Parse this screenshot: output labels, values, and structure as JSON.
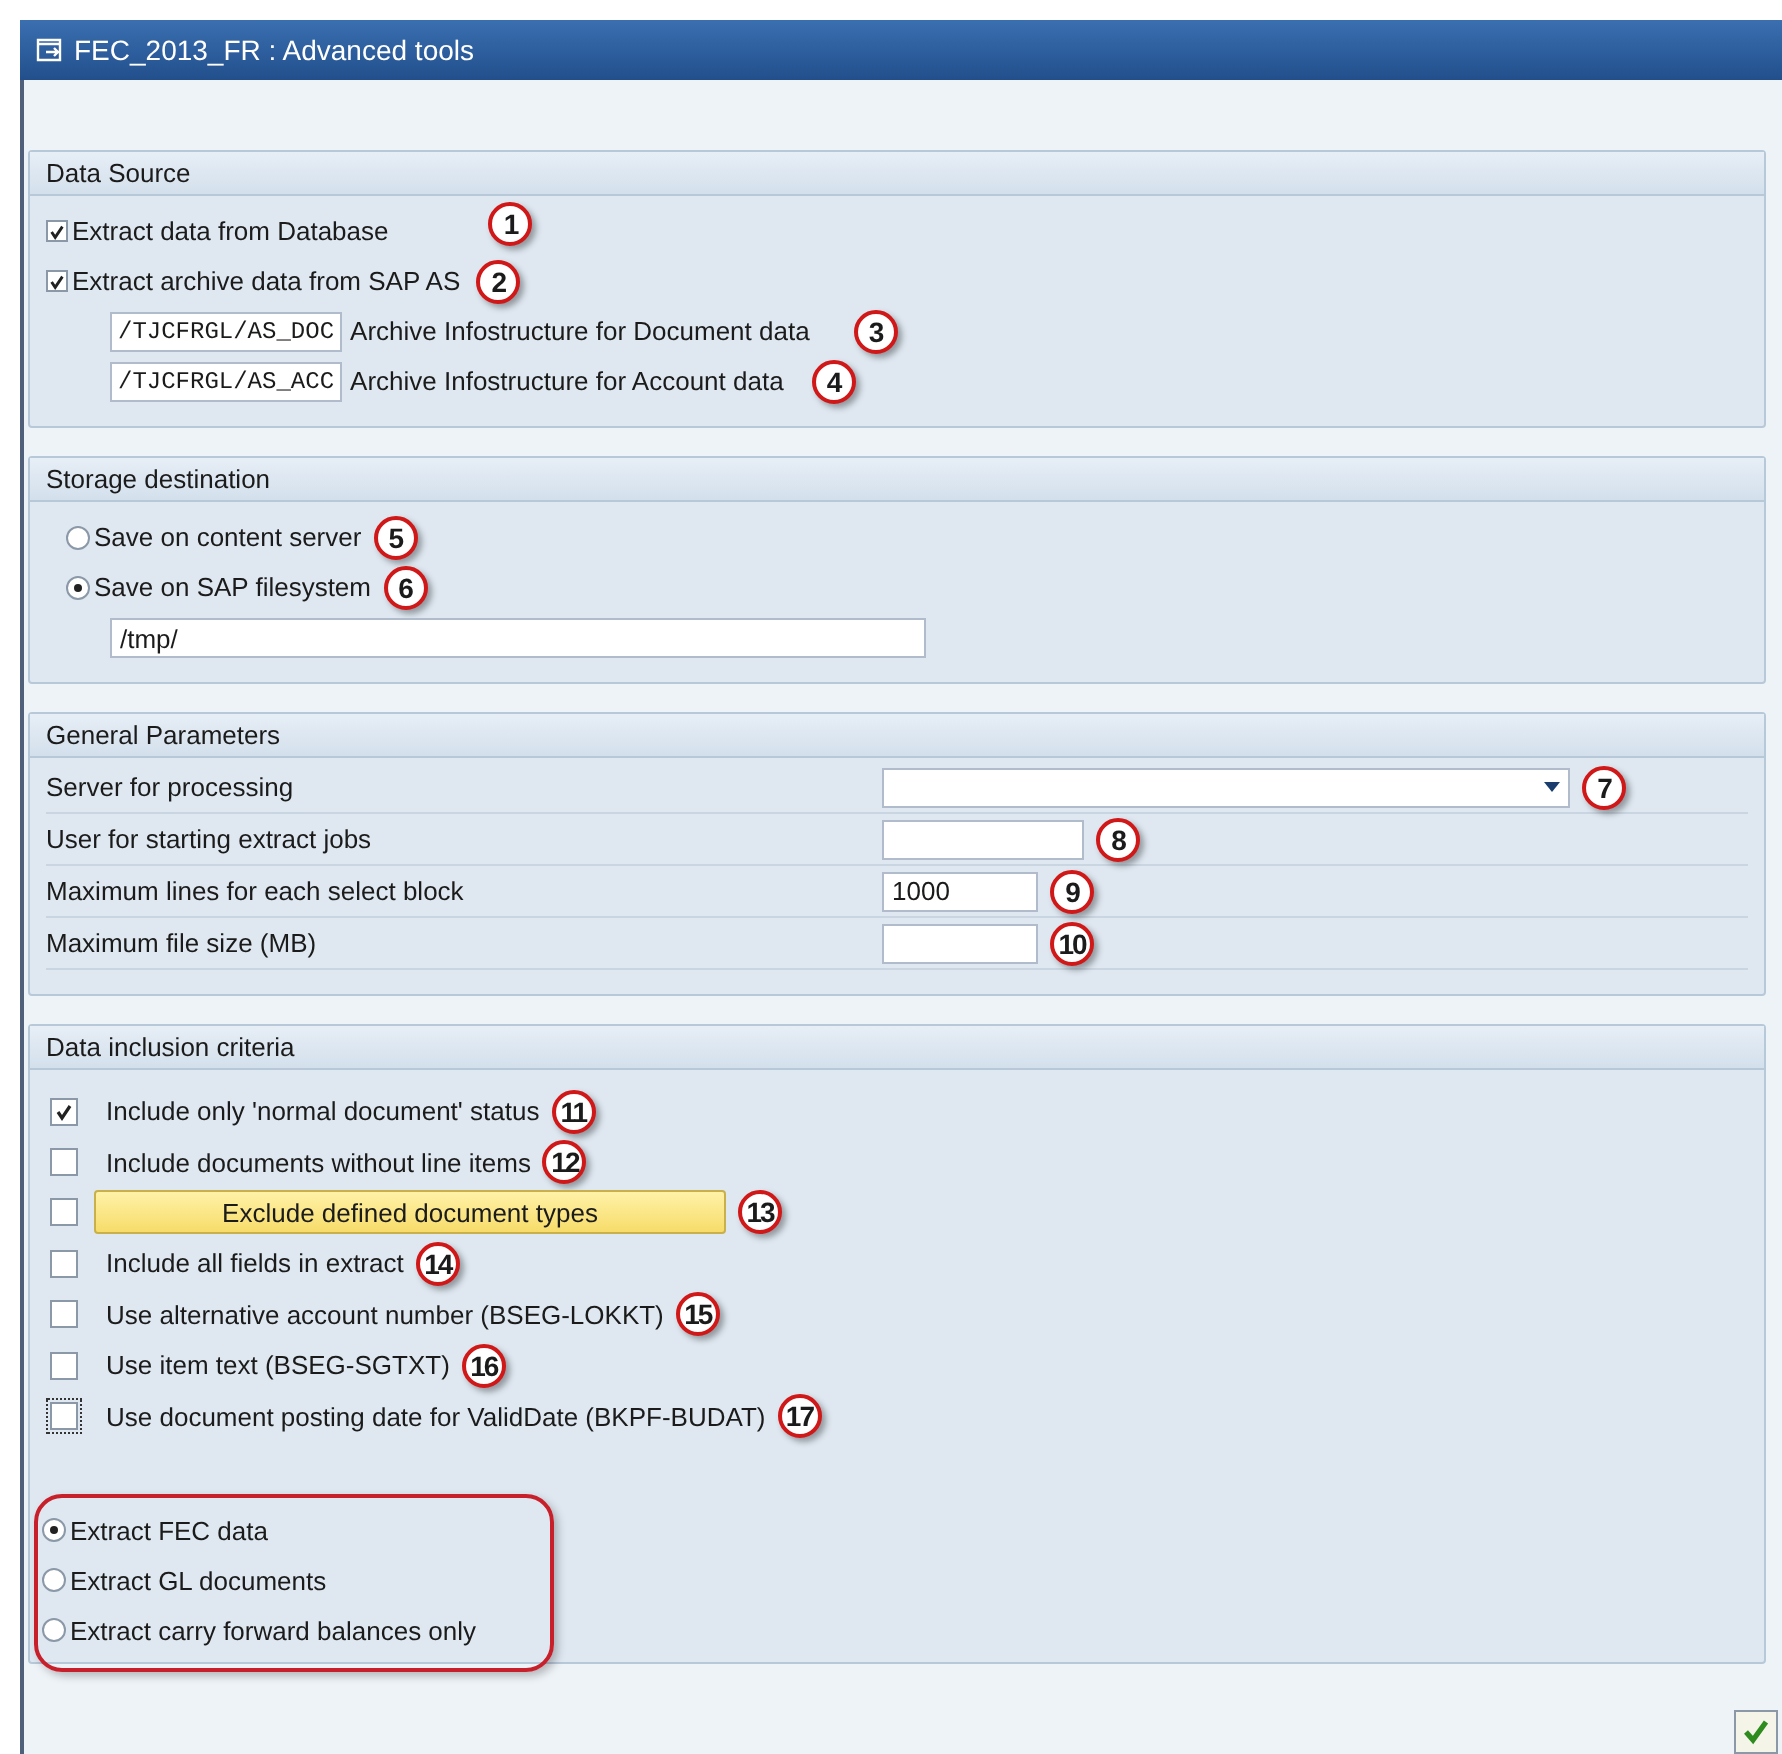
{
  "window": {
    "title": "FEC_2013_FR : Advanced tools"
  },
  "data_source": {
    "title": "Data Source",
    "checkboxes": [
      {
        "label": "Extract data from Database",
        "checked": true,
        "callout": "1"
      },
      {
        "label": "Extract archive data from SAP AS",
        "checked": true,
        "callout": "2"
      }
    ],
    "archive_fields": [
      {
        "value": "/TJCFRGL/AS_DOC",
        "label": "Archive Infostructure for Document data",
        "callout": "3"
      },
      {
        "value": "/TJCFRGL/AS_ACC",
        "label": "Archive Infostructure for Account data",
        "callout": "4"
      }
    ]
  },
  "storage": {
    "title": "Storage destination",
    "radios": [
      {
        "label": "Save on content server",
        "selected": false,
        "callout": "5"
      },
      {
        "label": "Save on SAP filesystem",
        "selected": true,
        "callout": "6"
      }
    ],
    "path": "/tmp/"
  },
  "general": {
    "title": "General Parameters",
    "rows": [
      {
        "label": "Server for processing",
        "kind": "dropdown",
        "callout": "7"
      },
      {
        "label": "User for starting extract jobs",
        "kind": "text",
        "callout": "8"
      },
      {
        "label": "Maximum lines for each select block",
        "kind": "text",
        "value": "1000",
        "callout": "9"
      },
      {
        "label": "Maximum file size (MB)",
        "kind": "text",
        "callout": "10"
      }
    ]
  },
  "inclusion": {
    "title": "Data inclusion criteria",
    "rows": [
      {
        "kind": "checkbox",
        "label": "Include only 'normal document' status",
        "checked": true,
        "focused": false,
        "callout": "11"
      },
      {
        "kind": "checkbox",
        "label": "Include documents without line items",
        "checked": false,
        "focused": false,
        "callout": "12"
      },
      {
        "kind": "button",
        "label": "Exclude defined document types",
        "checked": false,
        "focused": false,
        "callout": "13"
      },
      {
        "kind": "checkbox",
        "label": "Include all fields in extract",
        "checked": false,
        "focused": false,
        "callout": "14"
      },
      {
        "kind": "checkbox",
        "label": "Use alternative account number (BSEG-LOKKT)",
        "checked": false,
        "focused": false,
        "callout": "15"
      },
      {
        "kind": "checkbox",
        "label": "Use item text (BSEG-SGTXT)",
        "checked": false,
        "focused": false,
        "callout": "16"
      },
      {
        "kind": "checkbox",
        "label": "Use document posting date for ValidDate (BKPF-BUDAT)",
        "checked": false,
        "focused": true,
        "callout": "17"
      }
    ],
    "radios": [
      {
        "label": "Extract FEC data",
        "selected": true
      },
      {
        "label": "Extract GL documents",
        "selected": false
      },
      {
        "label": "Extract carry forward balances only",
        "selected": false
      }
    ]
  }
}
